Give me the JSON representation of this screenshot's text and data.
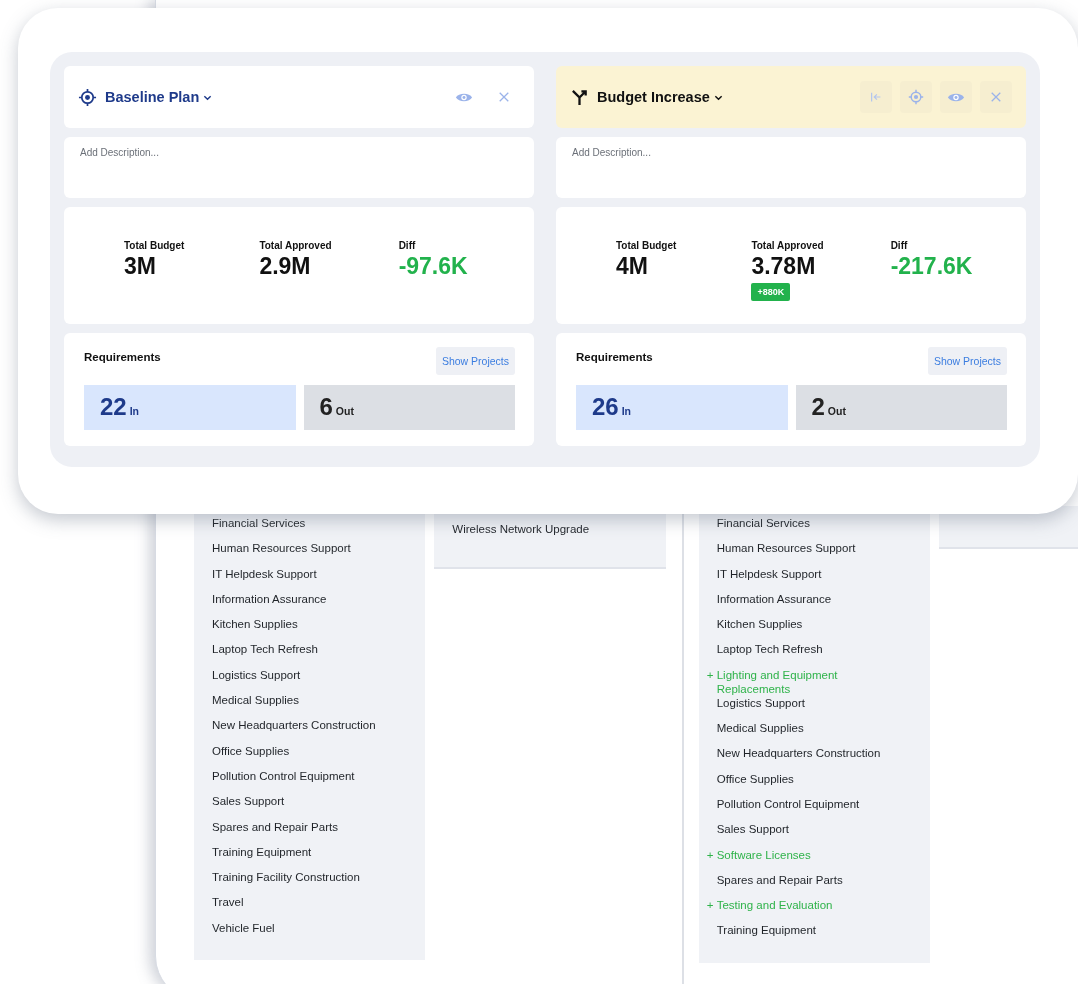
{
  "background_lists": [
    {
      "kind": "list",
      "items": [
        {
          "text": "Financial Services",
          "added": false
        },
        {
          "text": "Human Resources Support",
          "added": false
        },
        {
          "text": "IT Helpdesk Support",
          "added": false
        },
        {
          "text": "Information Assurance",
          "added": false
        },
        {
          "text": "Kitchen Supplies",
          "added": false
        },
        {
          "text": "Laptop Tech Refresh",
          "added": false
        },
        {
          "text": "Logistics Support",
          "added": false
        },
        {
          "text": "Medical Supplies",
          "added": false
        },
        {
          "text": "New Headquarters Construction",
          "added": false
        },
        {
          "text": "Office Supplies",
          "added": false
        },
        {
          "text": "Pollution Control Equipment",
          "added": false
        },
        {
          "text": "Sales Support",
          "added": false
        },
        {
          "text": "Spares and Repair Parts",
          "added": false
        },
        {
          "text": "Training Equipment",
          "added": false
        },
        {
          "text": "Training Facility Construction",
          "added": false
        },
        {
          "text": "Travel",
          "added": false
        },
        {
          "text": "Vehicle Fuel",
          "added": false
        }
      ]
    },
    {
      "kind": "short",
      "items": [
        {
          "text": "Wireless Network Upgrade",
          "added": false
        }
      ]
    },
    {
      "kind": "list",
      "items": [
        {
          "text": "Financial Services",
          "added": false
        },
        {
          "text": "Human Resources Support",
          "added": false
        },
        {
          "text": "IT Helpdesk Support",
          "added": false
        },
        {
          "text": "Information Assurance",
          "added": false
        },
        {
          "text": "Kitchen Supplies",
          "added": false
        },
        {
          "text": "Laptop Tech Refresh",
          "added": false
        },
        {
          "text": "Lighting and Equipment Replacements",
          "added": true,
          "marker": "+"
        },
        {
          "text": "Logistics Support",
          "added": false
        },
        {
          "text": "Medical Supplies",
          "added": false
        },
        {
          "text": "New Headquarters Construction",
          "added": false
        },
        {
          "text": "Office Supplies",
          "added": false
        },
        {
          "text": "Pollution Control Equipment",
          "added": false
        },
        {
          "text": "Sales Support",
          "added": false
        },
        {
          "text": "Software Licenses",
          "added": true,
          "marker": "+"
        },
        {
          "text": "Spares and Repair Parts",
          "added": false
        },
        {
          "text": "Testing and Evaluation",
          "added": true,
          "marker": "+"
        },
        {
          "text": "Training Equipment",
          "added": false
        }
      ]
    },
    {
      "kind": "empty"
    }
  ],
  "scenarios": [
    {
      "kind": "baseline",
      "name": "Baseline Plan",
      "placeholder": "Add Description...",
      "metrics": [
        {
          "kind": "amount",
          "label": "Total Budget",
          "value": "3M"
        },
        {
          "kind": "amount",
          "label": "Total Approved",
          "value": "2.9M"
        },
        {
          "kind": "diff",
          "label": "Diff",
          "value": "-97.6K"
        }
      ],
      "requirements": {
        "title": "Requirements",
        "button": "Show Projects",
        "in_count": "22",
        "in_label": "In",
        "out_count": "6",
        "out_label": "Out"
      }
    },
    {
      "kind": "variant",
      "name": "Budget Increase",
      "placeholder": "Add Description...",
      "metrics": [
        {
          "kind": "amount",
          "label": "Total Budget",
          "value": "4M"
        },
        {
          "kind": "amount",
          "label": "Total Approved",
          "value": "3.78M",
          "badge": "+880K"
        },
        {
          "kind": "diff",
          "label": "Diff",
          "value": "-217.6K"
        }
      ],
      "requirements": {
        "title": "Requirements",
        "button": "Show Projects",
        "in_count": "26",
        "in_label": "In",
        "out_count": "2",
        "out_label": "Out"
      }
    }
  ]
}
